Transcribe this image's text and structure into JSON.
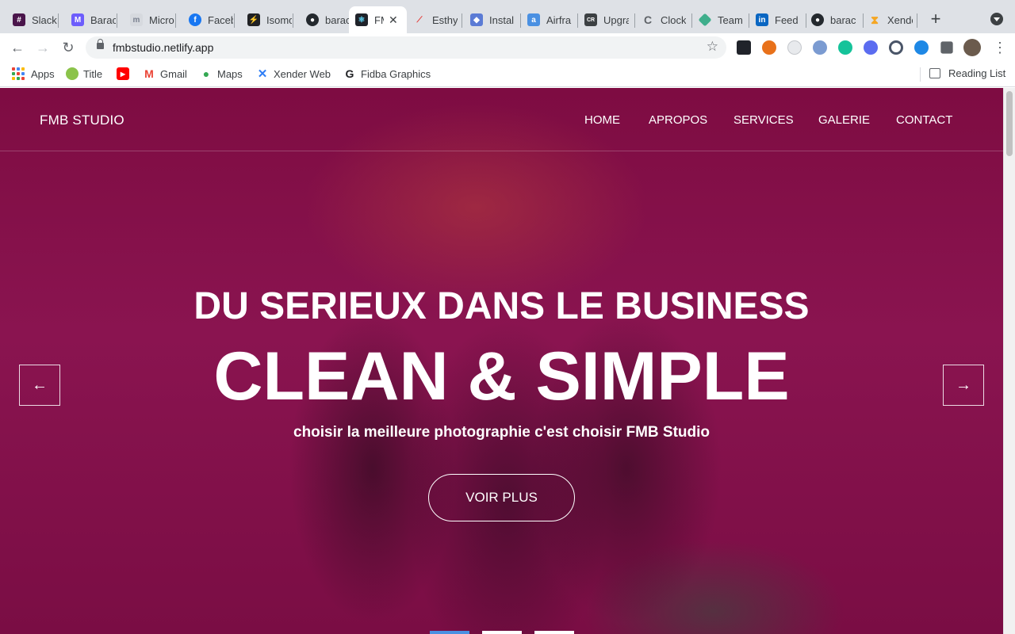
{
  "browser": {
    "tabs": [
      {
        "title": "Slack",
        "icon": "slack-icon",
        "color": "#4a154b"
      },
      {
        "title": "Barac",
        "icon": "barac-icon",
        "color": "#6d5dfc"
      },
      {
        "title": "Micro",
        "icon": "micro-icon",
        "color": "#b0b7c3"
      },
      {
        "title": "Faceb",
        "icon": "facebook-icon",
        "color": "#1877f2"
      },
      {
        "title": "Isomo",
        "icon": "isomorphic-icon",
        "color": "#202124"
      },
      {
        "title": "barac",
        "icon": "github-icon",
        "color": "#24292e"
      },
      {
        "title": "FM",
        "icon": "react-icon",
        "color": "#20232a",
        "active": true
      },
      {
        "title": "Esthy",
        "icon": "esthy-icon",
        "color": "#e53935"
      },
      {
        "title": "Instal",
        "icon": "install-icon",
        "color": "#5b7bd5"
      },
      {
        "title": "Airfra",
        "icon": "airframe-icon",
        "color": "#4a90e2"
      },
      {
        "title": "Upgra",
        "icon": "upgrade-icon",
        "color": "#3c4043"
      },
      {
        "title": "Clock",
        "icon": "clockify-icon",
        "color": "#9aa0a6"
      },
      {
        "title": "Team",
        "icon": "team-icon",
        "color": "#3fae8c"
      },
      {
        "title": "Feed",
        "icon": "linkedin-icon",
        "color": "#0a66c2"
      },
      {
        "title": "barac",
        "icon": "github-icon",
        "color": "#24292e"
      },
      {
        "title": "Xende",
        "icon": "xender-icon",
        "color": "#f5a623"
      }
    ],
    "url": "fmbstudio.netlify.app",
    "bookmarks": [
      {
        "label": "Apps",
        "icon": "apps-icon"
      },
      {
        "label": "Title",
        "icon": "title-icon"
      },
      {
        "label": "",
        "icon": "youtube-icon"
      },
      {
        "label": "Gmail",
        "icon": "gmail-icon"
      },
      {
        "label": "Maps",
        "icon": "maps-icon"
      },
      {
        "label": "Xender Web",
        "icon": "xender-icon"
      },
      {
        "label": "Fidba Graphics",
        "icon": "fidba-icon"
      }
    ],
    "reading_list": "Reading List"
  },
  "site": {
    "brand": "FMB STUDIO",
    "nav": [
      "HOME",
      "APROPOS",
      "SERVICES",
      "GALERIE",
      "CONTACT"
    ],
    "headline_top": "DU SERIEUX DANS LE BUSINESS",
    "headline_main": "CLEAN & SIMPLE",
    "tagline": "choisir la meilleure photographie c'est choisir FMB Studio",
    "cta": "VOIR PLUS",
    "prev_arrow": "←",
    "next_arrow": "→",
    "active_slide": 1,
    "slide_count": 3
  },
  "colors": {
    "hero_tint": "#7e0c42",
    "indicator_active": "#4a90e2",
    "indicator_inactive": "#ffffff"
  }
}
